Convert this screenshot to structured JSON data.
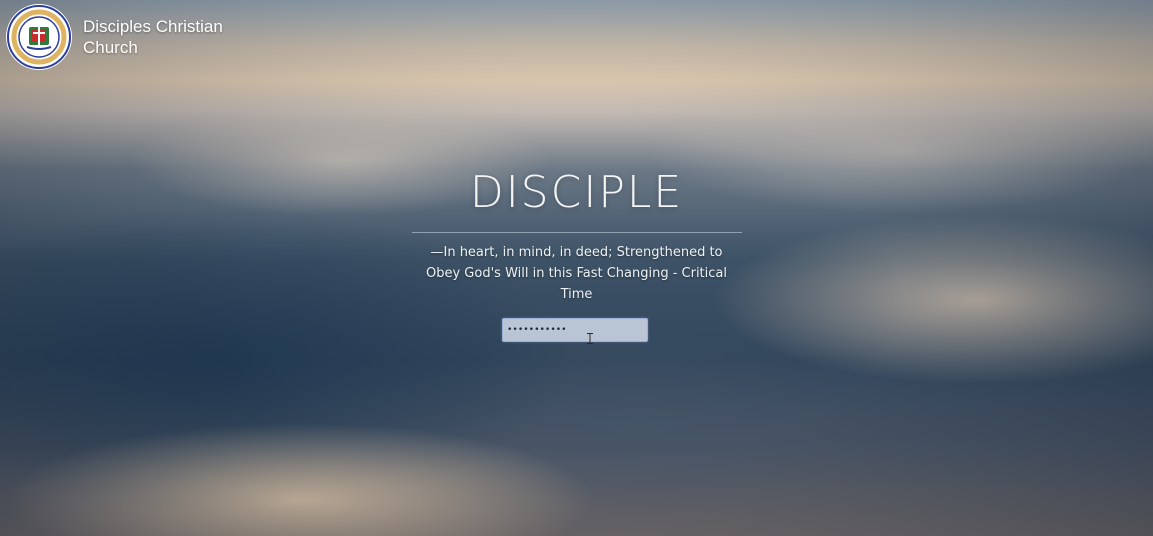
{
  "header": {
    "logo_icon": "church-crest-logo-icon",
    "logo_ring_text": "DISCIPLES CHRISTIAN CHURCH",
    "brand_name": "Disciples Christian Church"
  },
  "hero": {
    "title": "DISCIPLE",
    "tagline": "—In heart, in mind, in deed; Strengthened to Obey God's Will in this Fast Changing - Critical Time"
  },
  "login": {
    "password_value": "•••••••••••",
    "cursor_icon": "text-cursor-icon"
  },
  "colors": {
    "input_border": "#9bb0d6",
    "title_text": "#f4f4f4"
  }
}
